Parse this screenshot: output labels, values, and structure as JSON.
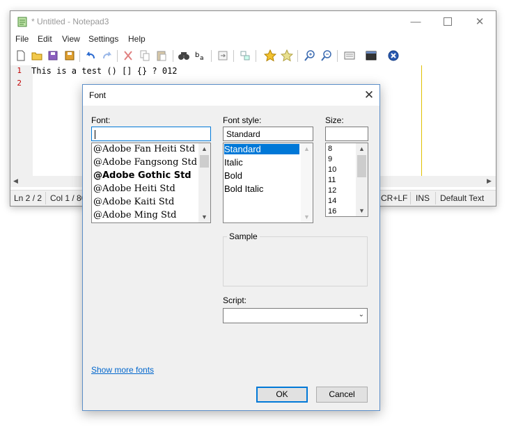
{
  "window": {
    "title": "* Untitled - Notepad3"
  },
  "menu": [
    "File",
    "Edit",
    "View",
    "Settings",
    "Help"
  ],
  "toolbar_icons": [
    "new-icon",
    "open-icon",
    "save-icon",
    "save-as-icon",
    "undo-icon",
    "redo-icon",
    "cut-icon",
    "copy-icon",
    "paste-icon",
    "find-icon",
    "replace-icon",
    "wrap-icon",
    "select-icon",
    "bookmark-icon",
    "bookmark-clear-icon",
    "zoom-in-icon",
    "zoom-out-icon",
    "settings-icon",
    "terminal-icon",
    "exit-icon"
  ],
  "editor": {
    "lines": [
      {
        "num": "1",
        "text": "This is a test () [] {} ? 012"
      },
      {
        "num": "2",
        "text": ""
      }
    ]
  },
  "status": {
    "ln": "Ln 2 / 2",
    "col": "Col 1 / 80",
    "eol": "CR+LF",
    "ins": "INS",
    "style": "Default Text"
  },
  "dialog": {
    "title": "Font",
    "font_label": "Font:",
    "font_value": "",
    "fonts": [
      "@Adobe Fan Heiti Std",
      "@Adobe Fangsong Std",
      "@Adobe Gothic Std",
      "@Adobe Heiti Std",
      "@Adobe Kaiti Std",
      "@Adobe Ming Std"
    ],
    "style_label": "Font style:",
    "style_value": "Standard",
    "styles": [
      "Standard",
      "Italic",
      "Bold",
      "Bold Italic"
    ],
    "selected_style": "Standard",
    "size_label": "Size:",
    "size_value": "",
    "sizes": [
      "8",
      "9",
      "10",
      "11",
      "12",
      "14",
      "16"
    ],
    "sample_label": "Sample",
    "script_label": "Script:",
    "script_value": "",
    "show_more": "Show more fonts",
    "ok": "OK",
    "cancel": "Cancel"
  },
  "colors": {
    "accent": "#0078d7",
    "linenum": "#c00000",
    "edge": "#e0c000",
    "link": "#0066cc"
  }
}
